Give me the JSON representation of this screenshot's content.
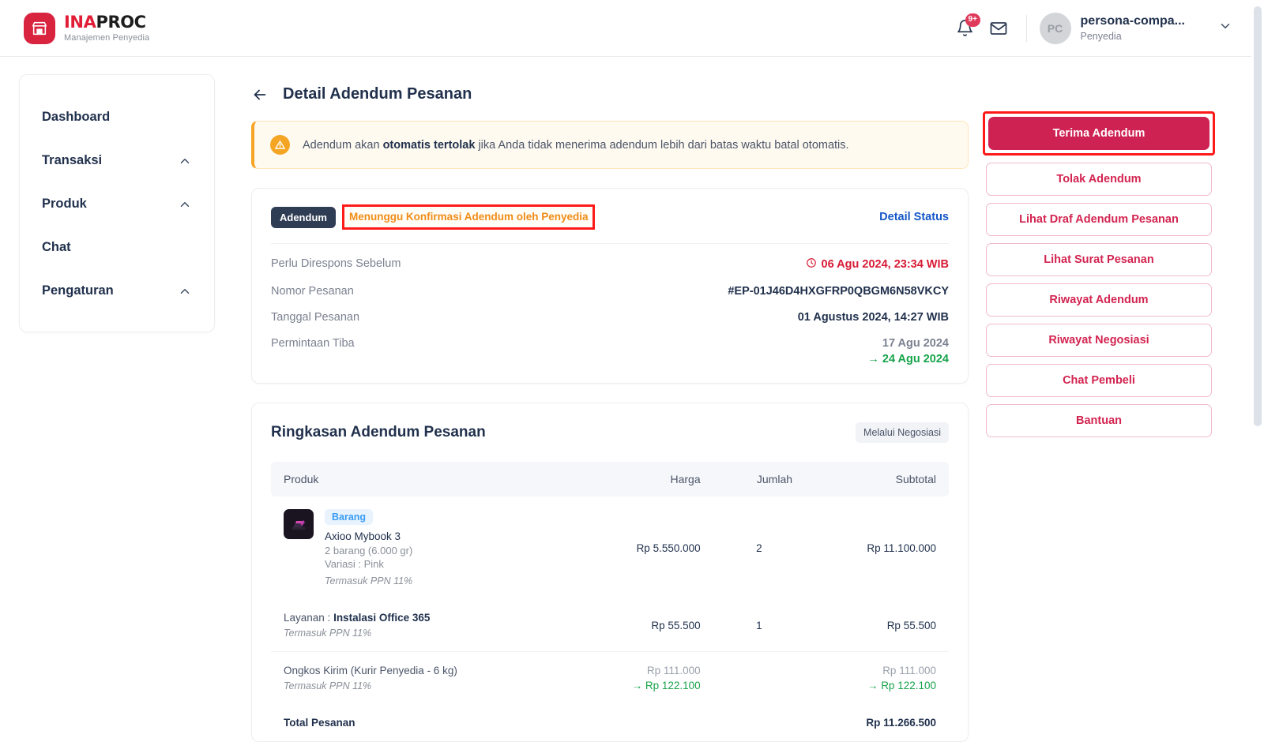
{
  "header": {
    "brand": {
      "title_red": "INA",
      "title_dark": "PROC",
      "subtitle": "Manajemen Penyedia"
    },
    "notification_badge": "9+",
    "user": {
      "initials": "PC",
      "name": "persona-compa...",
      "role": "Penyedia"
    }
  },
  "sidebar": {
    "items": [
      {
        "label": "Dashboard",
        "expandable": false
      },
      {
        "label": "Transaksi",
        "expandable": true
      },
      {
        "label": "Produk",
        "expandable": true
      },
      {
        "label": "Chat",
        "expandable": false
      },
      {
        "label": "Pengaturan",
        "expandable": true
      }
    ]
  },
  "page": {
    "title": "Detail Adendum Pesanan",
    "alert": {
      "text_before": "Adendum akan ",
      "text_bold": "otomatis tertolak",
      "text_after": " jika Anda tidak menerima adendum lebih dari batas waktu batal otomatis."
    }
  },
  "status_card": {
    "tag": "Adendum",
    "status": "Menunggu Konfirmasi Adendum oleh Penyedia",
    "detail_link": "Detail Status",
    "rows": [
      {
        "label": "Perlu Direspons Sebelum",
        "value": "06 Agu 2024, 23:34 WIB",
        "style": "red-clock"
      },
      {
        "label": "Nomor Pesanan",
        "value": "#EP-01J46D4HXGFRP0QBGM6N58VKCY",
        "style": "bold"
      },
      {
        "label": "Tanggal Pesanan",
        "value": "01 Agustus 2024, 14:27 WIB",
        "style": "bold"
      },
      {
        "label": "Permintaan Tiba",
        "value": "17 Agu 2024",
        "value_new": "24 Agu 2024",
        "style": "changed"
      }
    ]
  },
  "summary": {
    "title": "Ringkasan Adendum Pesanan",
    "badge": "Melalui Negosiasi",
    "columns": {
      "product": "Produk",
      "price": "Harga",
      "qty": "Jumlah",
      "subtotal": "Subtotal"
    },
    "items": [
      {
        "chip": "Barang",
        "name": "Axioo Mybook 3",
        "sub": "2 barang (6.000 gr)",
        "variant": "Variasi   : Pink",
        "ppn": "Termasuk PPN 11%",
        "price": "Rp 5.550.000",
        "qty": "2",
        "subtotal": "Rp 11.100.000"
      }
    ],
    "service": {
      "label": "Layanan : ",
      "name": "Instalasi Office 365",
      "ppn": "Termasuk PPN 11%",
      "price": "Rp 55.500",
      "qty": "1",
      "subtotal": "Rp 55.500"
    },
    "shipping": {
      "label": "Ongkos Kirim (Kurir Penyedia - 6 kg)",
      "ppn": "Termasuk PPN 11%",
      "price_old": "Rp 111.000",
      "price_new": "Rp 122.100",
      "subtotal_old": "Rp 111.000",
      "subtotal_new": "Rp 122.100"
    },
    "total": {
      "label": "Total Pesanan",
      "value": "Rp 11.266.500"
    }
  },
  "actions": {
    "buttons": [
      {
        "label": "Terima Adendum",
        "variant": "primary",
        "highlighted": true
      },
      {
        "label": "Tolak Adendum",
        "variant": "outline"
      },
      {
        "label": "Lihat Draf Adendum Pesanan",
        "variant": "outline"
      },
      {
        "label": "Lihat Surat Pesanan",
        "variant": "outline"
      },
      {
        "label": "Riwayat Adendum",
        "variant": "outline"
      },
      {
        "label": "Riwayat Negosiasi",
        "variant": "outline"
      },
      {
        "label": "Chat Pembeli",
        "variant": "outline"
      },
      {
        "label": "Bantuan",
        "variant": "outline"
      }
    ]
  },
  "colors": {
    "brand_red": "#d92440",
    "primary_button": "#ce2253",
    "warning": "#f5a524",
    "status_orange": "#f08c18",
    "link_blue": "#1557c7",
    "danger_red": "#d81b35",
    "success_green": "#16a34a",
    "highlight_box": "#ff1a1a"
  }
}
